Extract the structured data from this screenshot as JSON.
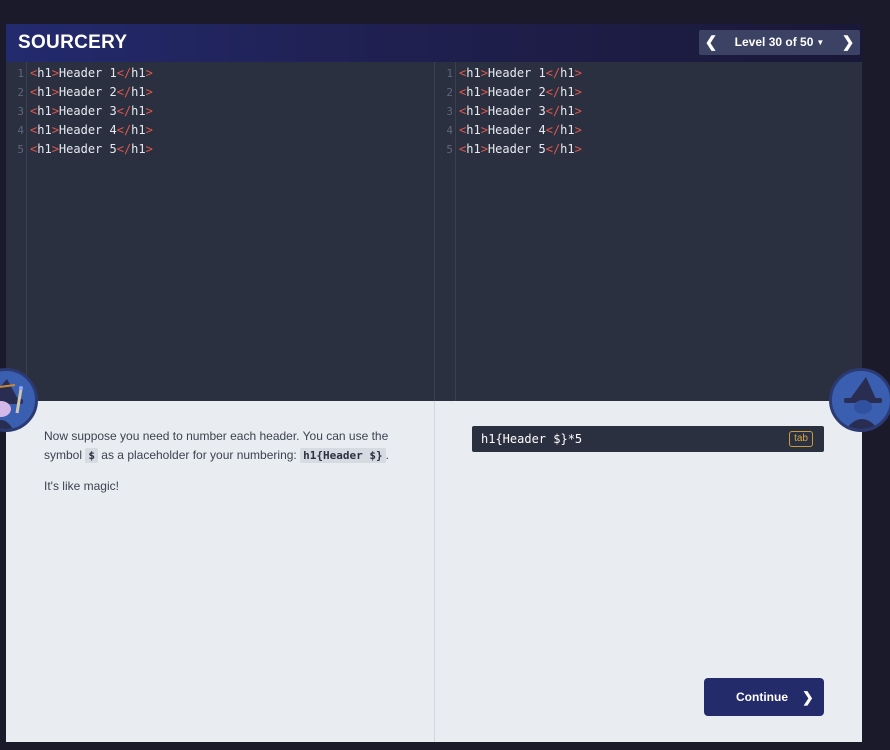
{
  "app": {
    "logo": "SOURCERY"
  },
  "header": {
    "prev_icon": "chevron-left-icon",
    "level_label": "Level 30 of 50",
    "dropdown_icon": "caret-down-icon",
    "next_icon": "chevron-right-icon"
  },
  "editor_left": {
    "lines": [
      {
        "num": "1",
        "open": "<",
        "tag": "h1",
        "close_open": ">",
        "text": "Header 1",
        "end_open": "</",
        "end_tag": "h1",
        "end_close": ">"
      },
      {
        "num": "2",
        "open": "<",
        "tag": "h1",
        "close_open": ">",
        "text": "Header 2",
        "end_open": "</",
        "end_tag": "h1",
        "end_close": ">"
      },
      {
        "num": "3",
        "open": "<",
        "tag": "h1",
        "close_open": ">",
        "text": "Header 3",
        "end_open": "</",
        "end_tag": "h1",
        "end_close": ">"
      },
      {
        "num": "4",
        "open": "<",
        "tag": "h1",
        "close_open": ">",
        "text": "Header 4",
        "end_open": "</",
        "end_tag": "h1",
        "end_close": ">"
      },
      {
        "num": "5",
        "open": "<",
        "tag": "h1",
        "close_open": ">",
        "text": "Header 5",
        "end_open": "</",
        "end_tag": "h1",
        "end_close": ">"
      }
    ]
  },
  "editor_right": {
    "lines": [
      {
        "num": "1",
        "open": "<",
        "tag": "h1",
        "close_open": ">",
        "text": "Header 1",
        "end_open": "</",
        "end_tag": "h1",
        "end_close": ">"
      },
      {
        "num": "2",
        "open": "<",
        "tag": "h1",
        "close_open": ">",
        "text": "Header 2",
        "end_open": "</",
        "end_tag": "h1",
        "end_close": ">"
      },
      {
        "num": "3",
        "open": "<",
        "tag": "h1",
        "close_open": ">",
        "text": "Header 3",
        "end_open": "</",
        "end_tag": "h1",
        "end_close": ">"
      },
      {
        "num": "4",
        "open": "<",
        "tag": "h1",
        "close_open": ">",
        "text": "Header 4",
        "end_open": "</",
        "end_tag": "h1",
        "end_close": ">"
      },
      {
        "num": "5",
        "open": "<",
        "tag": "h1",
        "close_open": ">",
        "text": "Header 5",
        "end_open": "</",
        "end_tag": "h1",
        "end_close": ">"
      }
    ]
  },
  "instruction": {
    "p1_before": "Now suppose you need to number each header. You can use the symbol ",
    "p1_symbol": "$",
    "p1_middle": " as a placeholder for your numbering: ",
    "p1_code": "h1{Header $}",
    "p1_after": ".",
    "p2": "It's like magic!"
  },
  "input": {
    "value": "h1{Header $}*5",
    "badge": "tab"
  },
  "continue_button": {
    "label": "Continue",
    "icon": "chevron-right-icon"
  },
  "avatars": {
    "left": "wizard-avatar-icon",
    "right": "wizard-avatar-icon"
  },
  "colors": {
    "editor_bg": "#2b3040",
    "tag_bracket": "#e2574c",
    "panel_bg": "#e9edf1",
    "button_bg": "#242b6a",
    "badge": "#d9a543"
  }
}
